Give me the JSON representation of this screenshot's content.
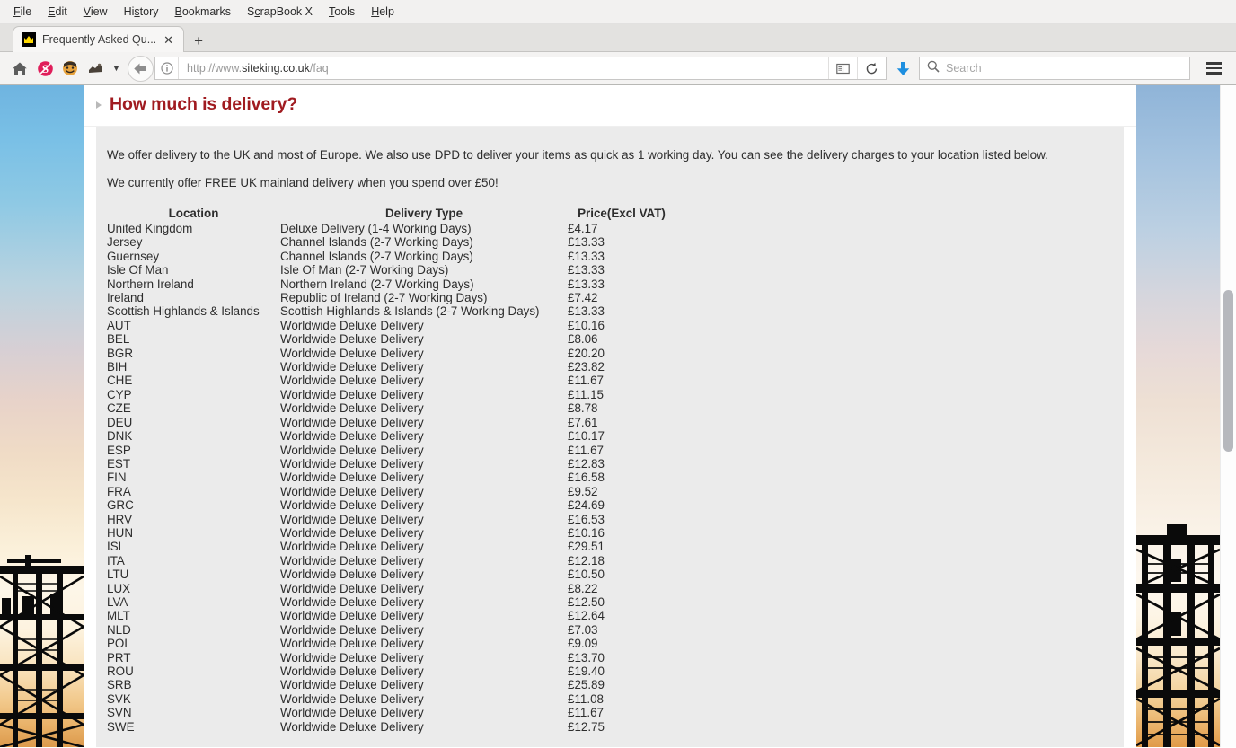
{
  "browser": {
    "menubar": [
      {
        "label": "File",
        "accel": "F"
      },
      {
        "label": "Edit",
        "accel": "E"
      },
      {
        "label": "View",
        "accel": "V"
      },
      {
        "label": "History",
        "accel": "s"
      },
      {
        "label": "Bookmarks",
        "accel": "B"
      },
      {
        "label": "ScrapBook X",
        "accel": "c"
      },
      {
        "label": "Tools",
        "accel": "T"
      },
      {
        "label": "Help",
        "accel": "H"
      }
    ],
    "tab": {
      "title": "Frequently Asked Qu...",
      "favicon": "crown-icon",
      "close_label": "✕"
    },
    "newtab_label": "+",
    "toolbar": {
      "home_icon": "home-icon",
      "scrapbook_icon": "scrapbook-s-icon",
      "smiley_icon": "smiley-icon",
      "extension_icon": "extension-icon",
      "dropdown_icon": "chevron-down-icon",
      "back_icon": "back-arrow-icon",
      "download_icon": "download-arrow-icon",
      "menu_icon": "hamburger-menu-icon"
    },
    "url": {
      "scheme": "http://www.",
      "domain": "siteking.co.uk",
      "path": "/faq",
      "full": "http://www.siteking.co.uk/faq",
      "info_icon": "info-circle-icon",
      "reader_icon": "reader-view-icon",
      "reload_icon": "reload-icon"
    },
    "search": {
      "placeholder": "Search",
      "icon": "search-icon"
    }
  },
  "page": {
    "heading": "How much is delivery?",
    "paragraph1": "We offer delivery to the UK and most of Europe. We also use DPD to deliver your items as quick as 1 working day. You can see the delivery charges to your location listed below.",
    "paragraph2": "We currently offer FREE UK mainland delivery when you spend over £50!",
    "accent_color": "#a01b20",
    "panel_color": "#ebebeb",
    "table": {
      "headers": [
        "Location",
        "Delivery Type",
        "Price(Excl VAT)"
      ],
      "rows": [
        [
          "United Kingdom",
          "Deluxe Delivery (1-4 Working Days)",
          "£4.17"
        ],
        [
          "Jersey",
          "Channel Islands (2-7 Working Days)",
          "£13.33"
        ],
        [
          "Guernsey",
          "Channel Islands (2-7 Working Days)",
          "£13.33"
        ],
        [
          "Isle Of Man",
          "Isle Of Man (2-7 Working Days)",
          "£13.33"
        ],
        [
          "Northern Ireland",
          "Northern Ireland (2-7 Working Days)",
          "£13.33"
        ],
        [
          "Ireland",
          "Republic of Ireland (2-7 Working Days)",
          "£7.42"
        ],
        [
          "Scottish Highlands & Islands",
          "Scottish Highlands & Islands (2-7 Working Days)",
          "£13.33"
        ],
        [
          "AUT",
          "Worldwide Deluxe Delivery",
          "£10.16"
        ],
        [
          "BEL",
          "Worldwide Deluxe Delivery",
          "£8.06"
        ],
        [
          "BGR",
          "Worldwide Deluxe Delivery",
          "£20.20"
        ],
        [
          "BIH",
          "Worldwide Deluxe Delivery",
          "£23.82"
        ],
        [
          "CHE",
          "Worldwide Deluxe Delivery",
          "£11.67"
        ],
        [
          "CYP",
          "Worldwide Deluxe Delivery",
          "£11.15"
        ],
        [
          "CZE",
          "Worldwide Deluxe Delivery",
          "£8.78"
        ],
        [
          "DEU",
          "Worldwide Deluxe Delivery",
          "£7.61"
        ],
        [
          "DNK",
          "Worldwide Deluxe Delivery",
          "£10.17"
        ],
        [
          "ESP",
          "Worldwide Deluxe Delivery",
          "£11.67"
        ],
        [
          "EST",
          "Worldwide Deluxe Delivery",
          "£12.83"
        ],
        [
          "FIN",
          "Worldwide Deluxe Delivery",
          "£16.58"
        ],
        [
          "FRA",
          "Worldwide Deluxe Delivery",
          "£9.52"
        ],
        [
          "GRC",
          "Worldwide Deluxe Delivery",
          "£24.69"
        ],
        [
          "HRV",
          "Worldwide Deluxe Delivery",
          "£16.53"
        ],
        [
          "HUN",
          "Worldwide Deluxe Delivery",
          "£10.16"
        ],
        [
          "ISL",
          "Worldwide Deluxe Delivery",
          "£29.51"
        ],
        [
          "ITA",
          "Worldwide Deluxe Delivery",
          "£12.18"
        ],
        [
          "LTU",
          "Worldwide Deluxe Delivery",
          "£10.50"
        ],
        [
          "LUX",
          "Worldwide Deluxe Delivery",
          "£8.22"
        ],
        [
          "LVA",
          "Worldwide Deluxe Delivery",
          "£12.50"
        ],
        [
          "MLT",
          "Worldwide Deluxe Delivery",
          "£12.64"
        ],
        [
          "NLD",
          "Worldwide Deluxe Delivery",
          "£7.03"
        ],
        [
          "POL",
          "Worldwide Deluxe Delivery",
          "£9.09"
        ],
        [
          "PRT",
          "Worldwide Deluxe Delivery",
          "£13.70"
        ],
        [
          "ROU",
          "Worldwide Deluxe Delivery",
          "£19.40"
        ],
        [
          "SRB",
          "Worldwide Deluxe Delivery",
          "£25.89"
        ],
        [
          "SVK",
          "Worldwide Deluxe Delivery",
          "£11.08"
        ],
        [
          "SVN",
          "Worldwide Deluxe Delivery",
          "£11.67"
        ],
        [
          "SWE",
          "Worldwide Deluxe Delivery",
          "£12.75"
        ]
      ]
    }
  }
}
